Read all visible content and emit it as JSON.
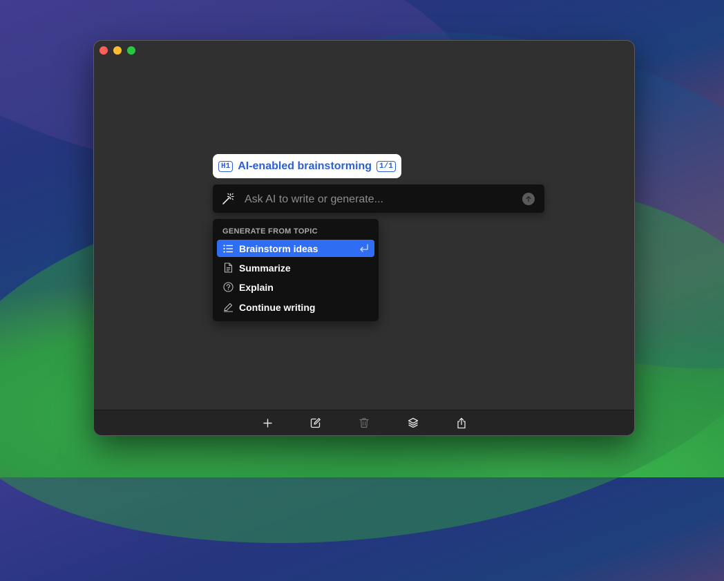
{
  "heading": {
    "level_tag": "H1",
    "title": "AI-enabled brainstorming",
    "counter": "1/1"
  },
  "prompt": {
    "placeholder": "Ask AI to write or generate..."
  },
  "menu": {
    "section_title": "GENERATE FROM TOPIC",
    "items": [
      {
        "label": "Brainstorm ideas",
        "icon": "list-icon",
        "active": true
      },
      {
        "label": "Summarize",
        "icon": "document-icon",
        "active": false
      },
      {
        "label": "Explain",
        "icon": "question-circle-icon",
        "active": false
      },
      {
        "label": "Continue writing",
        "icon": "pencil-icon",
        "active": false
      }
    ]
  },
  "toolbar": {
    "buttons": [
      "add-icon",
      "compose-icon",
      "trash-icon",
      "layers-icon",
      "share-icon"
    ]
  },
  "colors": {
    "accent": "#2f6ef2",
    "heading_text": "#2b5fd9",
    "window_bg": "#303030",
    "menu_bg": "#111111"
  }
}
